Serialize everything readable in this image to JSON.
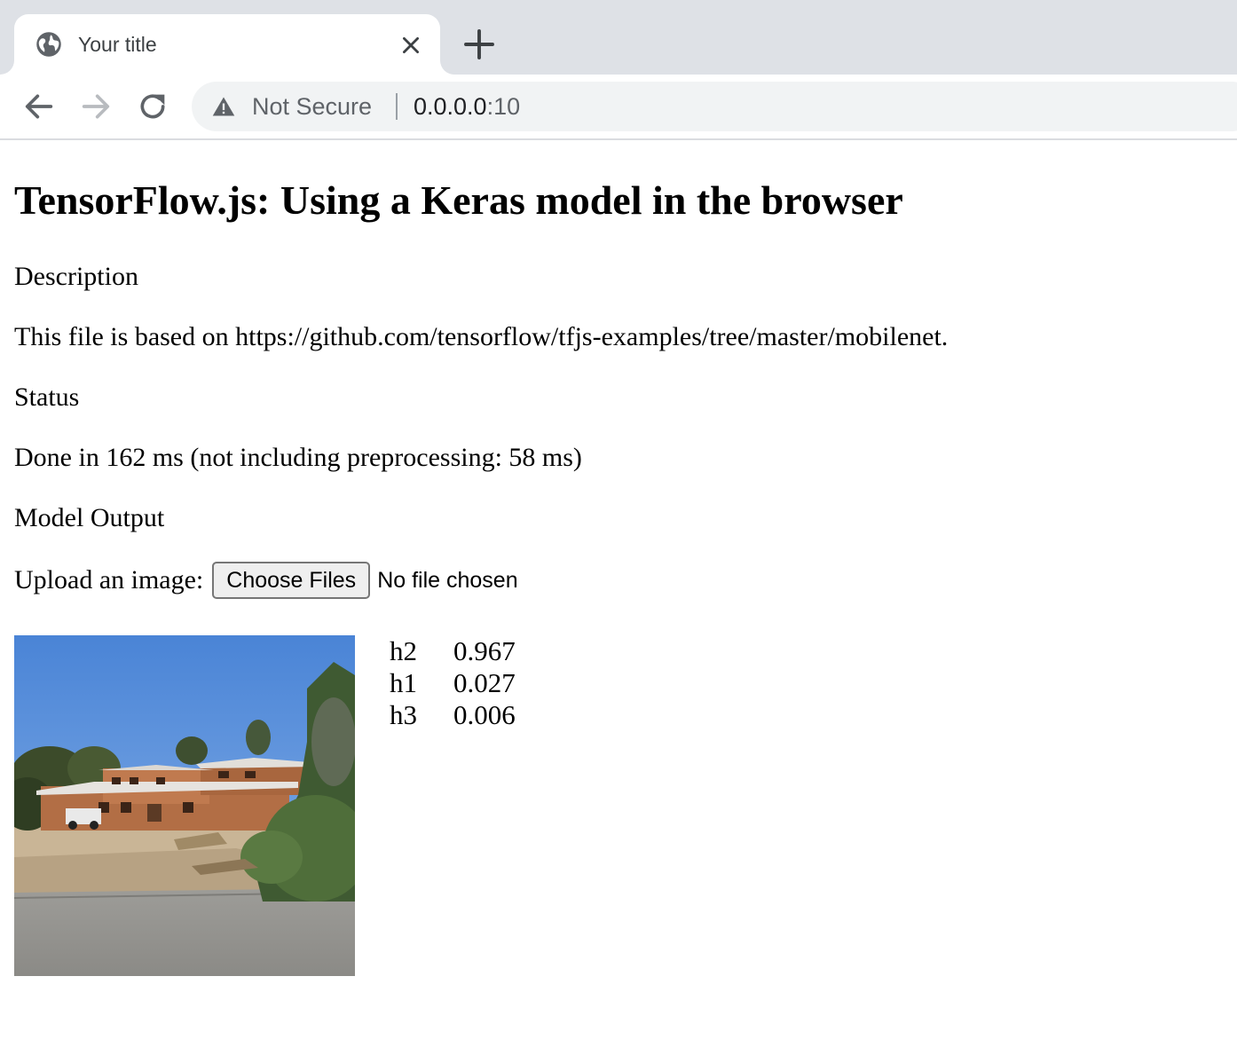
{
  "browser": {
    "tab": {
      "title": "Your title",
      "favicon": "globe-icon",
      "close_icon": "close-icon"
    },
    "new_tab_icon": "plus-icon",
    "nav": {
      "back_icon": "arrow-left-icon",
      "forward_icon": "arrow-right-icon",
      "reload_icon": "reload-icon"
    },
    "omnibox": {
      "security_icon": "warning-icon",
      "security_label": "Not Secure",
      "url_host": "0.0.0.0",
      "url_port": ":10"
    },
    "colors": {
      "tabstrip": "#dee1e6",
      "omnibox": "#f1f3f4",
      "chrome_text": "#5f6368"
    }
  },
  "page": {
    "title": "TensorFlow.js: Using a Keras model in the browser",
    "description_heading": "Description",
    "description_text": "This file is based on https://github.com/tensorflow/tfjs-examples/tree/master/mobilenet.",
    "status_heading": "Status",
    "status_text": "Done in 162 ms (not including preprocessing: 58 ms)",
    "model_output_heading": "Model Output",
    "upload": {
      "label": "Upload an image:",
      "button_label": "Choose Files",
      "file_status": "No file chosen"
    },
    "predictions": [
      {
        "class": "h2",
        "probability": "0.967"
      },
      {
        "class": "h1",
        "probability": "0.027"
      },
      {
        "class": "h3",
        "probability": "0.006"
      }
    ]
  }
}
